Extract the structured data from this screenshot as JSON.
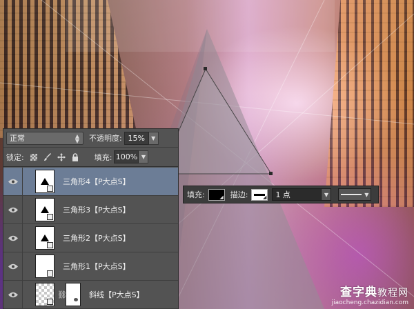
{
  "layers_panel": {
    "blend_mode": "正常",
    "opacity_label": "不透明度:",
    "opacity_value": "15%",
    "lock_label": "锁定:",
    "fill_label": "填充:",
    "fill_value": "100%",
    "layers": [
      {
        "name": "三角形4【P大点S】",
        "selected": true
      },
      {
        "name": "三角形3【P大点S】",
        "selected": false
      },
      {
        "name": "三角形2【P大点S】",
        "selected": false
      },
      {
        "name": "三角形1【P大点S】",
        "selected": false
      },
      {
        "name": "斜线【P大点S】",
        "selected": false
      }
    ]
  },
  "shape_options": {
    "fill_label": "填充:",
    "fill_color": "#000000",
    "stroke_label": "描边:",
    "stroke_width": "1 点"
  },
  "watermark": {
    "brand_main": "查字典",
    "brand_sub": "教程网",
    "url": "jiaocheng.chazidian.com"
  }
}
